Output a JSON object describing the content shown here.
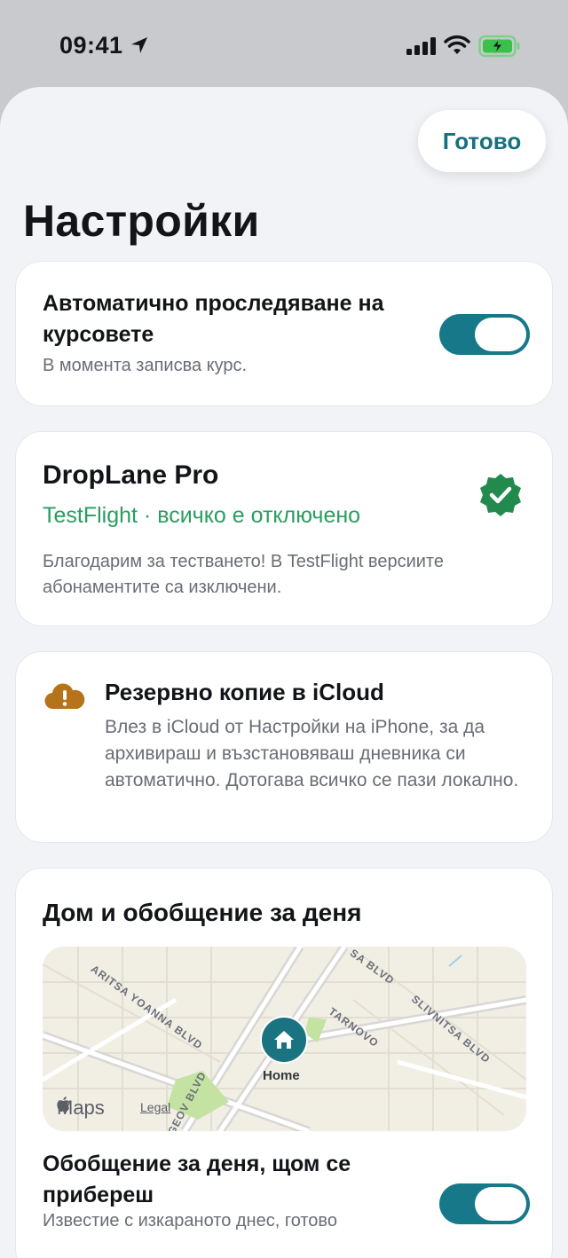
{
  "status_bar": {
    "time": "09:41"
  },
  "header": {
    "done_label": "Готово",
    "title": "Настройки"
  },
  "auto_tracking": {
    "title": "Автоматично проследяване на курсовете",
    "subtitle": "В момента записва курс.",
    "enabled": true
  },
  "pro": {
    "title": "DropLane Pro",
    "status": "TestFlight · всичко е отключено",
    "note": "Благодарим за тестването! В TestFlight версиите абонаментите са изключени."
  },
  "icloud": {
    "title": "Резервно копие в iCloud",
    "text": "Влез в iCloud от Настройки на iPhone, за да архивираш и възстановяваш дневника си автоматично. Дотогава всичко се пази локално."
  },
  "home": {
    "title": "Дом и обобщение за деня",
    "map": {
      "pin_label": "Home",
      "brand": "Maps",
      "legal": "Legal",
      "streets": [
        "ARITSA YOANNA BLVD",
        "SA BLVD",
        "TARNOVO",
        "SLIVNITSA BLVD",
        "GEOV BLVD"
      ]
    },
    "summary_title": "Обобщение за деня, щом се прибереш",
    "summary_subtitle": "Известие с изкараното днес, готово",
    "summary_enabled": true
  },
  "colors": {
    "accent": "#17788a",
    "success": "#2a9d5f",
    "warning": "#b5731a"
  }
}
